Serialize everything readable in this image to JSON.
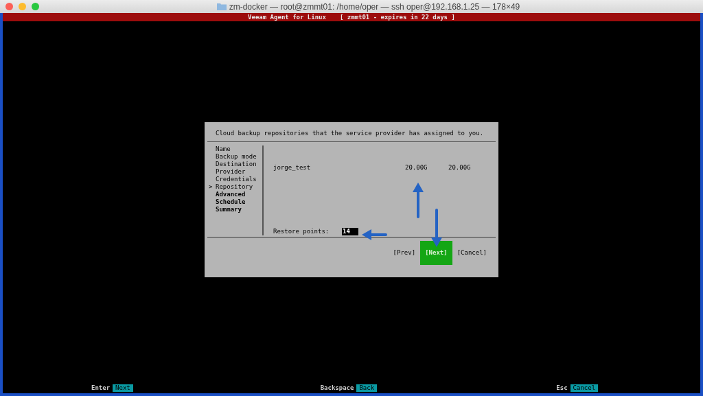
{
  "window": {
    "title": "zm-docker — root@zmmt01: /home/oper — ssh oper@192.168.1.25 — 178×49"
  },
  "header": {
    "app": "Veeam Agent for Linux",
    "license": "[ zmmt01 - expires in 22 days ]"
  },
  "dialog": {
    "description": "Cloud backup repositories that the service provider has assigned to you.",
    "steps": [
      {
        "label": "Name",
        "selected": false,
        "completed": true
      },
      {
        "label": "Backup mode",
        "selected": false,
        "completed": true
      },
      {
        "label": "Destination",
        "selected": false,
        "completed": true
      },
      {
        "label": "Provider",
        "selected": false,
        "completed": true
      },
      {
        "label": "Credentials",
        "selected": false,
        "completed": true
      },
      {
        "label": "Repository",
        "selected": true,
        "completed": true,
        "marker": ">"
      },
      {
        "label": "Advanced",
        "selected": false,
        "completed": false
      },
      {
        "label": "Schedule",
        "selected": false,
        "completed": false
      },
      {
        "label": "Summary",
        "selected": false,
        "completed": false
      }
    ],
    "repositories": [
      {
        "name": "jorge_test",
        "column_2": "20.00G",
        "column_3": "20.00G"
      }
    ],
    "restore_points": {
      "label": "Restore points:",
      "value": "14"
    },
    "buttons": [
      {
        "label": "[Prev]",
        "selected": false
      },
      {
        "label": "[Next]",
        "selected": true
      },
      {
        "label": "[Cancel]",
        "selected": false
      }
    ]
  },
  "hints": [
    {
      "key": "Enter",
      "action": "Next"
    },
    {
      "key": "Backspace",
      "action": "Back"
    },
    {
      "key": "Esc",
      "action": "Cancel"
    }
  ]
}
